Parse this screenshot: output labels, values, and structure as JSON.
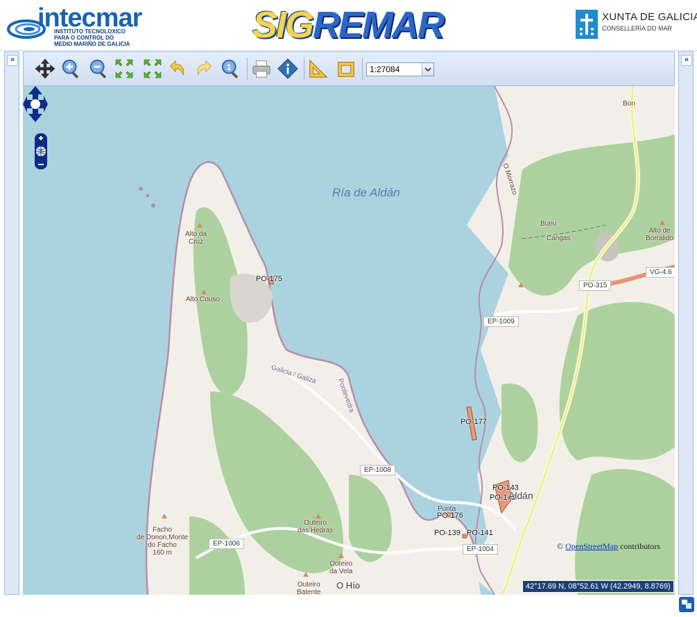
{
  "header": {
    "intecmar_word": "intecmar",
    "intecmar_sub_1": "INSTITUTO TECNOLOXICO",
    "intecmar_sub_2": "PARA O CONTROL DO",
    "intecmar_sub_3": "MEDIO MARIÑO DE GALICIA",
    "sigremar_a": "SIG",
    "sigremar_b": "REMAR",
    "xunta_title": "XUNTA DE GALICIA",
    "xunta_sub": "CONSELLERÍA DO MAR"
  },
  "panels": {
    "left_collapse": "»",
    "right_collapse": "«"
  },
  "toolbar": {
    "scale_value": "1:27084"
  },
  "map": {
    "bay_label": "Ría de Aldán",
    "parcels": [
      "PO-175",
      "PO-177",
      "PO-143",
      "PO-142",
      "PO-176",
      "PO-139",
      "PO-141"
    ],
    "places": {
      "alto_da_cruz_1": "Alto da",
      "alto_da_cruz_2": "Cruz",
      "alto_couso": "Alto Couso",
      "bon": "Bon",
      "bueu": "Bueu",
      "cangas": "Cangas",
      "o_morrazo": "O Morrazo",
      "alto_borralido_1": "Alto de",
      "alto_borralido_2": "Borralido",
      "galicia": "Galicia / Galiza",
      "pontevedra": "Pontevedra",
      "facho_1": "Facho",
      "facho_2": "de Donon,Monte",
      "facho_3": "do Facho",
      "facho_4": "160 m",
      "outeiro_hedras_1": "Outeiro",
      "outeiro_hedras_2": "das Hedras",
      "outeiro_vela_1": "Outeiro",
      "outeiro_vela_2": "da Vela",
      "outeiro_batente_1": "Outeiro",
      "outeiro_batente_2": "Batente",
      "o_hio": "O Hío",
      "punta": "Punta",
      "aldan": "Aldán"
    },
    "roads": {
      "ep1009": "EP-1009",
      "ep1008": "EP-1008",
      "ep1006": "EP-1006",
      "ep1004": "EP-1004",
      "po315": "PO-315",
      "vg46": "VG-4.6"
    },
    "attribution_link": "OpenStreetMap",
    "attribution_text": "contributors",
    "attribution_prefix": "©",
    "coordinates": "42°17.69 N, 08°52.61 W (42.2949, 8.8769)"
  }
}
